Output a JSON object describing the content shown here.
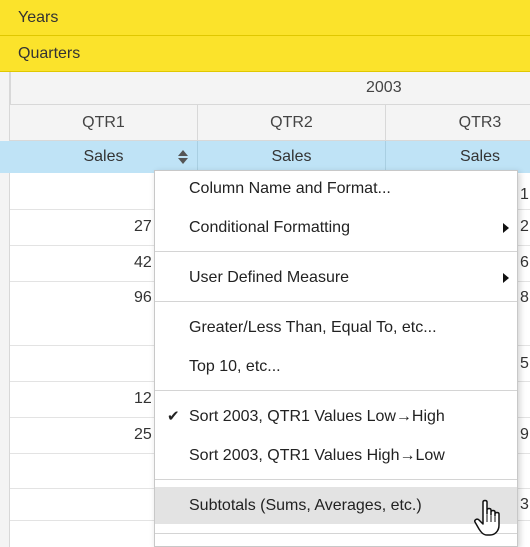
{
  "header": {
    "years_label": "Years",
    "quarters_label": "Quarters",
    "year_value": "2003"
  },
  "columns": [
    {
      "quarter": "QTR1",
      "measure": "Sales"
    },
    {
      "quarter": "QTR2",
      "measure": "Sales"
    },
    {
      "quarter": "QTR3",
      "measure": "Sales"
    }
  ],
  "col1_fragments": [
    "27",
    "42",
    "96",
    "12",
    "25"
  ],
  "col3_fragments": [
    "1",
    "2",
    "6",
    "8",
    "5",
    "9",
    "3"
  ],
  "context_menu": {
    "items": [
      {
        "label": "Column Name and Format...",
        "submenu": false,
        "checked": false
      },
      {
        "label": "Conditional Formatting",
        "submenu": true,
        "checked": false
      },
      {
        "label": "User Defined Measure",
        "submenu": true,
        "checked": false
      },
      {
        "label": "Greater/Less Than, Equal To, etc...",
        "submenu": false,
        "checked": false
      },
      {
        "label": "Top 10, etc...",
        "submenu": false,
        "checked": false
      },
      {
        "label": "Sort 2003, QTR1 Values Low→High",
        "submenu": false,
        "checked": true
      },
      {
        "label": "Sort 2003, QTR1 Values High→Low",
        "submenu": false,
        "checked": false
      },
      {
        "label": "Subtotals (Sums, Averages, etc.)",
        "submenu": false,
        "checked": false,
        "hovered": true
      }
    ],
    "check_glyph": "✔"
  },
  "colors": {
    "header_yellow": "#fbe32b",
    "sales_blue": "#bfe3f6",
    "menu_hover": "#e3e3e3"
  },
  "icons": [
    "sort-updown-icon",
    "submenu-arrow-icon",
    "checkmark-icon",
    "hand-pointer-cursor-icon"
  ]
}
